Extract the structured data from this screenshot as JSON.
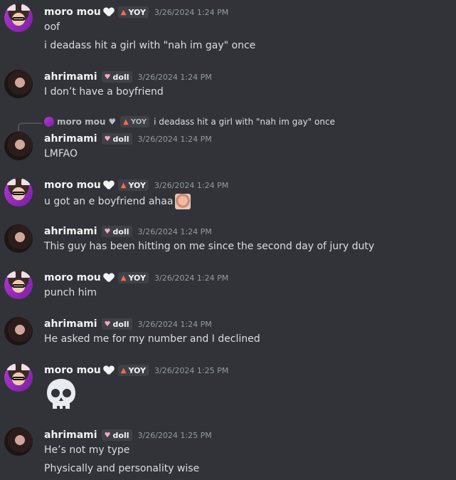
{
  "messages": [
    {
      "user": "moro mou",
      "tag": "YOY",
      "time": "3/26/2024 1:24 PM",
      "lines": [
        "oof",
        "i deadass hit a girl with \"nah im gay\" once"
      ]
    },
    {
      "user": "ahrimami",
      "tag": "doll",
      "time": "3/26/2024 1:24 PM",
      "lines": [
        "I don’t have a boyfriend"
      ]
    },
    {
      "reply": {
        "user": "moro mou",
        "tag": "YOY",
        "text": "i deadass hit a girl with \"nah im gay\" once"
      },
      "user": "ahrimami",
      "tag": "doll",
      "time": "3/26/2024 1:24 PM",
      "lines": [
        "LMFAO"
      ]
    },
    {
      "user": "moro mou",
      "tag": "YOY",
      "time": "3/26/2024 1:24 PM",
      "lines": [
        "u got an e boyfriend ahaa"
      ],
      "emoji": "face-emoji"
    },
    {
      "user": "ahrimami",
      "tag": "doll",
      "time": "3/26/2024 1:24 PM",
      "lines": [
        "This guy has been hitting on me since the second day of jury duty"
      ]
    },
    {
      "user": "moro mou",
      "tag": "YOY",
      "time": "3/26/2024 1:24 PM",
      "lines": [
        "punch him"
      ]
    },
    {
      "user": "ahrimami",
      "tag": "doll",
      "time": "3/26/2024 1:24 PM",
      "lines": [
        "He asked me for my number and I declined"
      ]
    },
    {
      "user": "moro mou",
      "tag": "YOY",
      "time": "3/26/2024 1:25 PM",
      "emoji": "skull-emoji"
    },
    {
      "user": "ahrimami",
      "tag": "doll",
      "time": "3/26/2024 1:25 PM",
      "lines": [
        "He’s not my type",
        "Physically and personality wise"
      ]
    }
  ],
  "colors": {
    "background": "#313338",
    "username": "#f2f3f5",
    "timestamp": "#949ba4",
    "text": "#dbdee1",
    "tag_bg": "#3f4147"
  }
}
